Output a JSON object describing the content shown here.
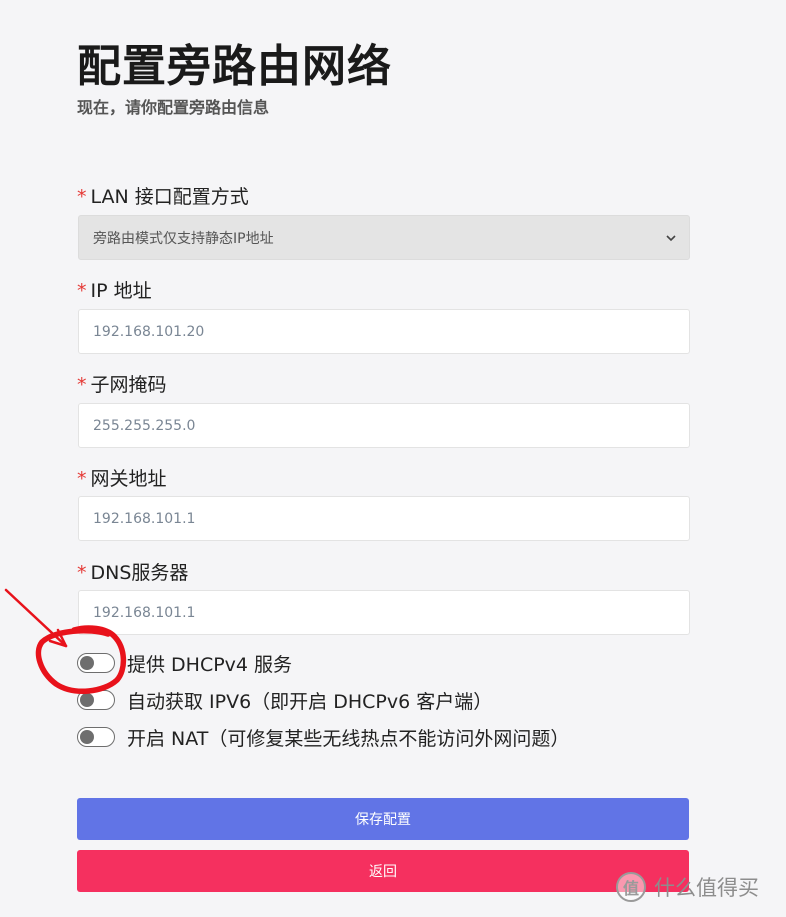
{
  "header": {
    "title": "配置旁路由网络",
    "subtitle": "现在，请你配置旁路由信息"
  },
  "form": {
    "required_mark": "*",
    "lan_mode": {
      "label": "LAN 接口配置方式",
      "selected": "旁路由模式仅支持静态IP地址"
    },
    "ip": {
      "label": "IP 地址",
      "value": "192.168.101.20"
    },
    "netmask": {
      "label": "子网掩码",
      "value": "255.255.255.0"
    },
    "gateway": {
      "label": "网关地址",
      "value": "192.168.101.1"
    },
    "dns": {
      "label": "DNS服务器",
      "value": "192.168.101.1"
    },
    "toggles": {
      "dhcp": {
        "label": "提供 DHCPv4 服务",
        "on": false
      },
      "ipv6": {
        "label": "自动获取 IPV6（即开启 DHCPv6 客户端）",
        "on": false
      },
      "nat": {
        "label": "开启 NAT（可修复某些无线热点不能访问外网问题）",
        "on": false
      }
    }
  },
  "buttons": {
    "save": "保存配置",
    "back": "返回"
  },
  "annotation": {
    "color": "#e8121b"
  },
  "watermark": {
    "logo": "值",
    "text": "什么值得买"
  },
  "colors": {
    "accent": "#6174e6",
    "danger": "#f5305f",
    "required": "#e53935"
  },
  "icons": {
    "select_arrow": "chevron-down-icon",
    "annotation_arrow": "arrow-icon",
    "watermark_logo": "watermark-logo-icon"
  }
}
